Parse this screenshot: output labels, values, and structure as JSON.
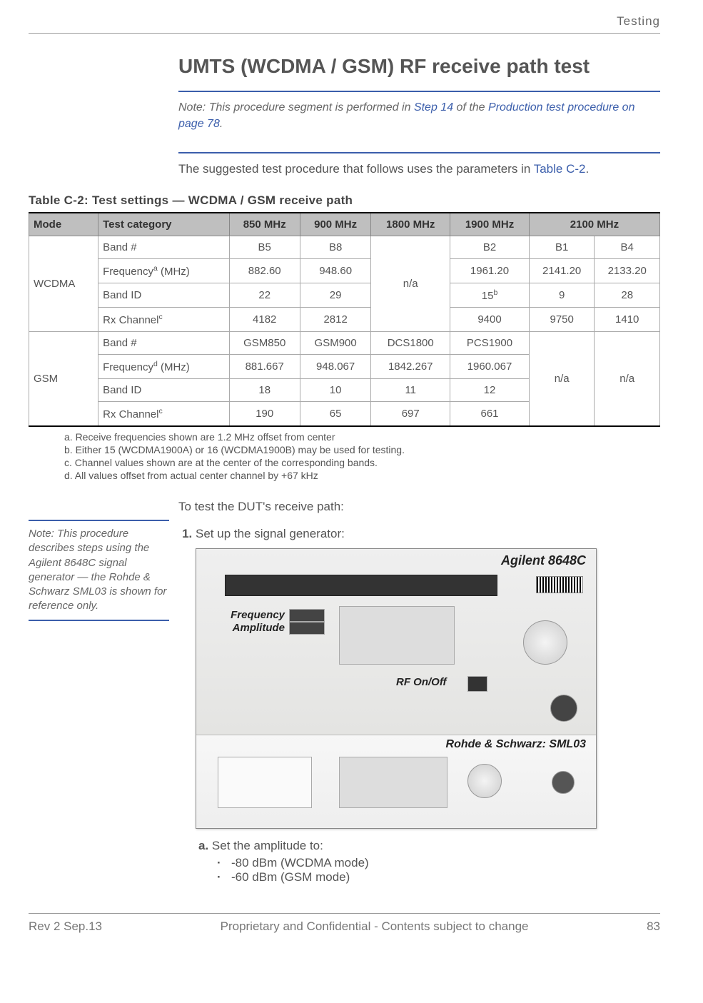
{
  "header": {
    "section": "Testing"
  },
  "title": "UMTS (WCDMA / GSM) RF receive path test",
  "note": {
    "prefix": "Note:  This procedure segment is performed in ",
    "step_link": "Step 14",
    "mid": " of the ",
    "proc_link": "Production test procedure on page 78",
    "suffix": "."
  },
  "intro": {
    "text": "The suggested test procedure that follows uses the parameters in ",
    "link": "Table C-2",
    "suffix": "."
  },
  "table": {
    "caption": "Table C-2:  Test settings — WCDMA / GSM receive path",
    "headers": {
      "mode": "Mode",
      "cat": "Test category",
      "c850": "850 MHz",
      "c900": "900 MHz",
      "c1800": "1800 MHz",
      "c1900": "1900 MHz",
      "c2100": "2100 MHz"
    },
    "wcdma": {
      "mode": "WCDMA",
      "rows": {
        "band_num": {
          "cat": "Band #",
          "c850": "B5",
          "c900": "B8",
          "c1900": "B2",
          "c2100a": "B1",
          "c2100b": "B4"
        },
        "freq": {
          "cat_base": "Frequency",
          "cat_sup": "a",
          "cat_suffix": " (MHz)",
          "c850": "882.60",
          "c900": "948.60",
          "c1900": "1961.20",
          "c2100a": "2141.20",
          "c2100b": "2133.20"
        },
        "band_id": {
          "cat": "Band ID",
          "c850": "22",
          "c900": "29",
          "c1900_base": "15",
          "c1900_sup": "b",
          "c2100a": "9",
          "c2100b": "28"
        },
        "rx": {
          "cat_base": "Rx Channel",
          "cat_sup": "c",
          "c850": "4182",
          "c900": "2812",
          "c1900": "9400",
          "c2100a": "9750",
          "c2100b": "1410"
        }
      },
      "na_1800": "n/a"
    },
    "gsm": {
      "mode": "GSM",
      "rows": {
        "band_num": {
          "cat": "Band #",
          "c850": "GSM850",
          "c900": "GSM900",
          "c1800": "DCS1800",
          "c1900": "PCS1900"
        },
        "freq": {
          "cat_base": "Frequency",
          "cat_sup": "d",
          "cat_suffix": " (MHz)",
          "c850": "881.667",
          "c900": "948.067",
          "c1800": "1842.267",
          "c1900": "1960.067"
        },
        "band_id": {
          "cat": "Band ID",
          "c850": "18",
          "c900": "10",
          "c1800": "11",
          "c1900": "12"
        },
        "rx": {
          "cat_base": "Rx Channel",
          "cat_sup": "c",
          "c850": "190",
          "c900": "65",
          "c1800": "697",
          "c1900": "661"
        }
      },
      "na_2100a": "n/a",
      "na_2100b": "n/a"
    }
  },
  "footnotes": {
    "a": "a.   Receive frequencies shown are 1.2 MHz offset from center",
    "b": "b.   Either 15 (WCDMA1900A) or 16 (WCDMA1900B) may be used for testing.",
    "c": "c.   Channel values shown are at the center of the corresponding bands.",
    "d": "d.   All values offset from actual center channel by +67 kHz"
  },
  "proc": {
    "lead": "To test the DUT's receive path:",
    "side_note": "Note:  This procedure describes steps using the Agilent 8648C signal generator — the Rohde & Schwarz SML03 is shown for reference only.",
    "step1": "Set up the signal generator:",
    "figure": {
      "agilent_label": "Agilent 8648C",
      "freq_label": "Frequency",
      "amp_label": "Amplitude",
      "rf_label": "RF On/Off",
      "rs_label": "Rohde & Schwarz: SML03"
    },
    "sub_a": {
      "label": "a.",
      "text": "Set the amplitude to:",
      "bullets": {
        "b1": "-80 dBm (WCDMA mode)",
        "b2": "-60 dBm (GSM mode)"
      }
    }
  },
  "footer": {
    "left": "Rev 2  Sep.13",
    "center": "Proprietary and Confidential - Contents subject to change",
    "right": "83"
  }
}
